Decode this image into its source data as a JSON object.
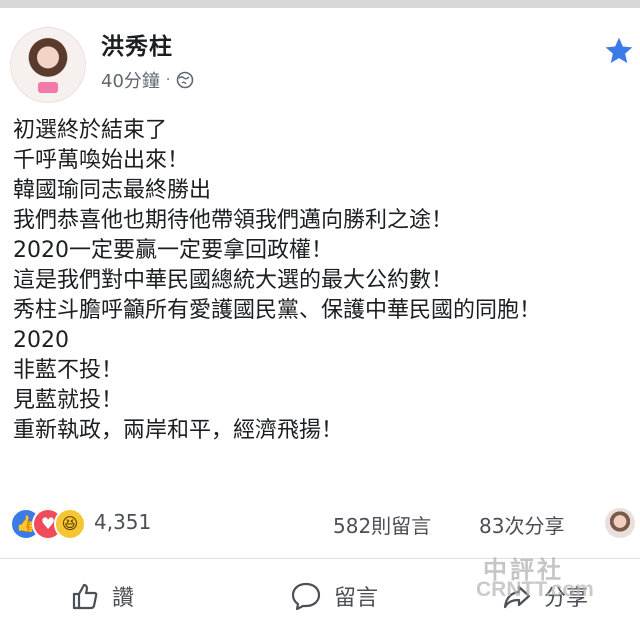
{
  "post": {
    "author": "洪秀柱",
    "timestamp": "40分鐘",
    "privacy_icon": "globe-icon",
    "star_icon": "star-icon",
    "star_color": "#3b7be8",
    "lines": [
      "初選終於結束了",
      "千呼萬喚始出來！",
      "韓國瑜同志最終勝出",
      "我們恭喜他也期待他帶領我們邁向勝利之途！",
      "2020一定要贏一定要拿回政權！",
      "這是我們對中華民國總統大選的最大公約數！",
      "秀柱斗膽呼籲所有愛護國民黨、保護中華民國的同胞！",
      "2020",
      "非藍不投！",
      "見藍就投！",
      "重新執政，兩岸和平，經濟飛揚！"
    ]
  },
  "stats": {
    "reaction_count": "4,351",
    "comments": "582則留言",
    "shares": "83次分享",
    "reaction_icons": [
      "like-reaction-icon",
      "love-reaction-icon",
      "haha-reaction-icon"
    ]
  },
  "actions": {
    "like_label": "讚",
    "comment_label": "留言",
    "share_label": "分享"
  },
  "watermark": {
    "line1": "中評社",
    "line2": "CRNTT.com"
  }
}
